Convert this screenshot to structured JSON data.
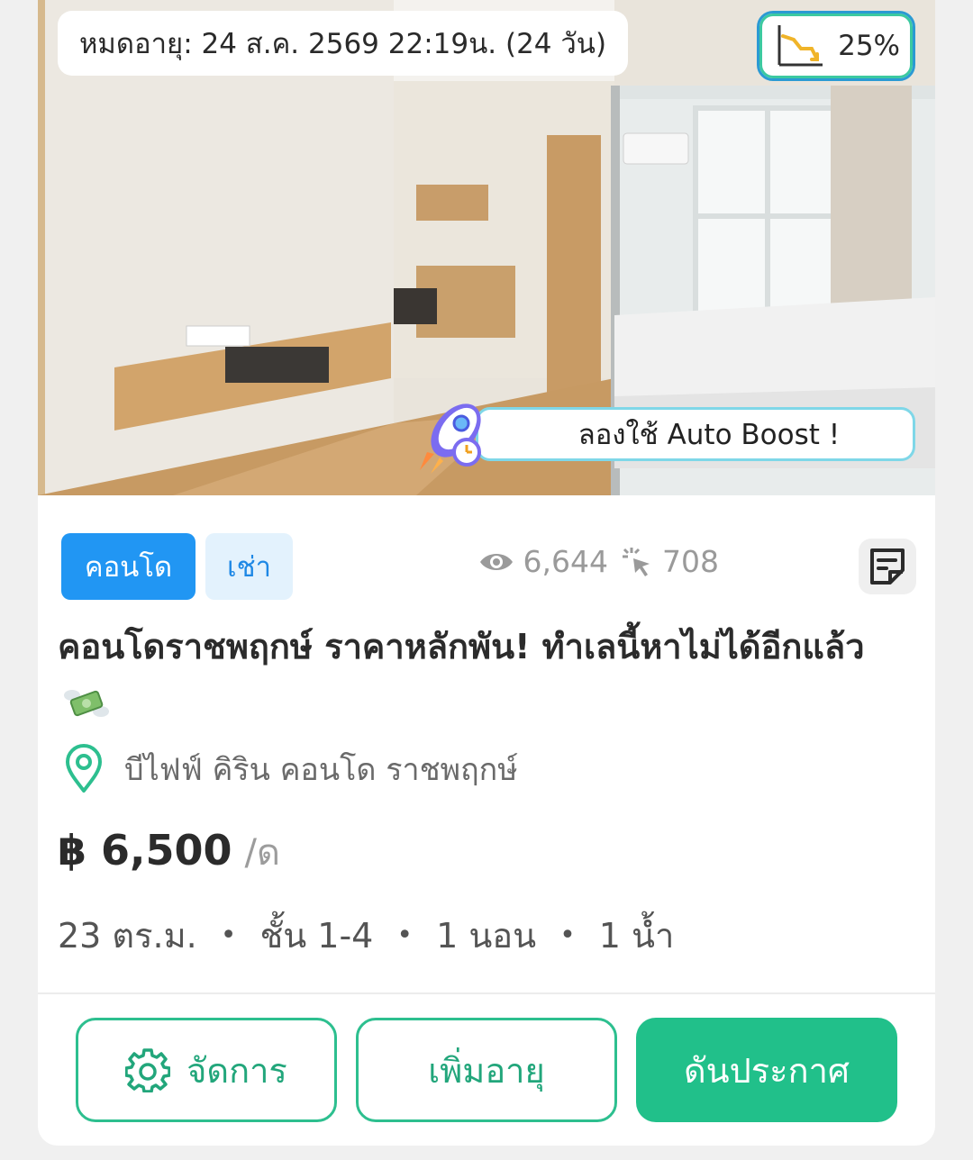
{
  "listing": {
    "expiry_text": "หมดอายุ: 24 ส.ค. 2569 22:19น. (24 วัน)",
    "boost_percent": "25%",
    "auto_boost_label": "ลองใช้ Auto Boost !",
    "tags": {
      "type": "คอนโด",
      "mode": "เช่า"
    },
    "stats": {
      "views": "6,644",
      "clicks": "708"
    },
    "title": "คอนโดราชพฤกษ์ ราคาหลักพัน! ทำเลนี้หาไม่ได้อีกแล้ว",
    "location": "บีไฟฟ์ คิริน คอนโด ราชพฤกษ์",
    "price": "฿ 6,500",
    "price_unit": "/ด",
    "specs": {
      "area": "23 ตร.ม.",
      "floor": "ชั้น 1-4",
      "bedrooms": "1 นอน",
      "bathrooms": "1 น้ำ"
    }
  },
  "actions": {
    "manage_label": "จัดการ",
    "extend_label": "เพิ่มอายุ",
    "boost_label": "ดันประกาศ"
  },
  "icons": {
    "chart": "chart-down-icon",
    "rocket": "rocket-icon",
    "views": "eye-icon",
    "clicks": "click-icon",
    "note": "note-icon",
    "money": "money-wings-icon",
    "location": "location-pin-icon",
    "manage": "gear-icon"
  },
  "colors": {
    "tag_condo_bg": "#2196f3",
    "tag_rent_bg": "#e3f2fd",
    "accent_green": "#21c08a",
    "boost_border": "#2b9ad3"
  }
}
